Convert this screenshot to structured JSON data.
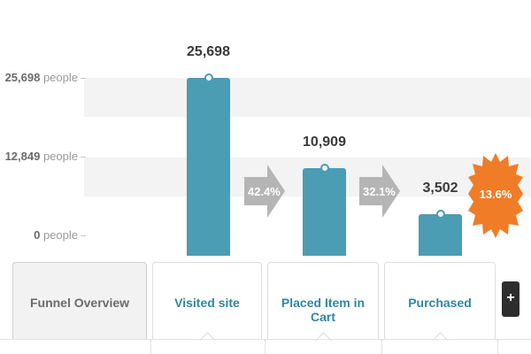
{
  "chart": {
    "y_axis": [
      {
        "value": "25,698",
        "unit": "people"
      },
      {
        "value": "12,849",
        "unit": "people"
      },
      {
        "value": "0",
        "unit": "people"
      }
    ],
    "bars": [
      {
        "label": "Visited site",
        "value": "25,698"
      },
      {
        "label": "Placed Item in Cart",
        "value": "10,909"
      },
      {
        "label": "Purchased",
        "value": "3,502"
      }
    ],
    "conversions": [
      "42.4%",
      "32.1%"
    ],
    "overall_conversion": "13.6%",
    "colors": {
      "bar": "#4a9db3",
      "arrow": "#b5b5b5",
      "burst": "#f07c27",
      "tab_text": "#2f87a0"
    }
  },
  "chart_data": {
    "type": "bar",
    "categories": [
      "Visited site",
      "Placed Item in Cart",
      "Purchased"
    ],
    "values": [
      25698,
      10909,
      3502
    ],
    "ylabel": "people",
    "ylim": [
      0,
      25698
    ],
    "yticks": [
      0,
      12849,
      25698
    ],
    "step_conversion_percent": [
      42.4,
      32.1
    ],
    "overall_conversion_percent": 13.6
  },
  "tabs": [
    {
      "label": "Funnel Overview"
    },
    {
      "label": "Visited site"
    },
    {
      "label": "Placed Item in Cart"
    },
    {
      "label": "Purchased"
    }
  ],
  "add_button": {
    "label": "+"
  }
}
